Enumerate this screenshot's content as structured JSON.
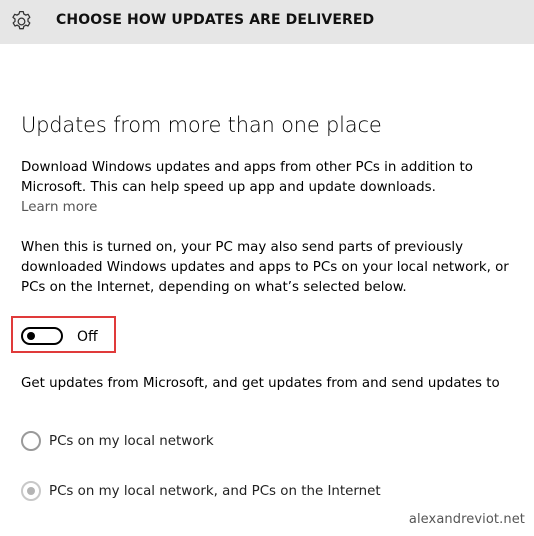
{
  "header": {
    "icon": "gear-icon",
    "title": "CHOOSE HOW UPDATES ARE DELIVERED",
    "background": "#e6e6e6"
  },
  "section": {
    "heading": "Updates from more than one place",
    "intro": "Download Windows updates and apps from other PCs in addition to Microsoft. This can help speed up app and update downloads.",
    "learn_more": "Learn more",
    "description": "When this is turned on, your PC may also send parts of previously downloaded Windows updates and apps to PCs on your local network, or PCs on the Internet, depending on what’s selected below."
  },
  "toggle": {
    "label": "Off",
    "state": "off",
    "highlight_color": "#e03a3a"
  },
  "options": {
    "prompt": "Get updates from Microsoft, and get updates from and send updates to",
    "items": [
      {
        "label": "PCs on my local network",
        "checked": false
      },
      {
        "label": "PCs on my local network, and PCs on the Internet",
        "checked": true
      }
    ]
  },
  "watermark": "alexandreviot.net"
}
